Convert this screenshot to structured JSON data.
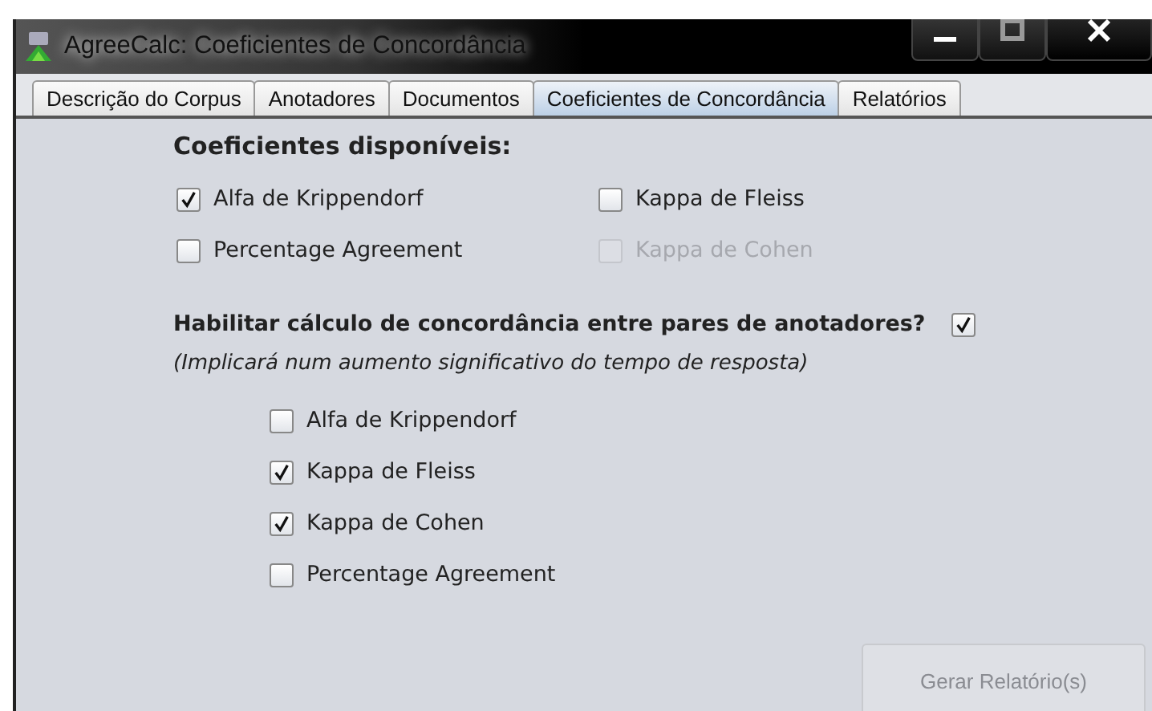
{
  "window": {
    "title": "AgreeCalc: Coeficientes de Concordância"
  },
  "tabs": [
    {
      "label": "Descrição do Corpus",
      "selected": false
    },
    {
      "label": "Anotadores",
      "selected": false
    },
    {
      "label": "Documentos",
      "selected": false
    },
    {
      "label": "Coeficientes de Concordância",
      "selected": true
    },
    {
      "label": "Relatórios",
      "selected": false
    }
  ],
  "available": {
    "heading": "Coeficientes disponíveis:",
    "options": [
      {
        "label": "Alfa de Krippendorf",
        "checked": true,
        "disabled": false
      },
      {
        "label": "Kappa de Fleiss",
        "checked": false,
        "disabled": false
      },
      {
        "label": "Percentage Agreement",
        "checked": false,
        "disabled": false
      },
      {
        "label": "Kappa de Cohen",
        "checked": false,
        "disabled": true
      }
    ]
  },
  "pairs": {
    "question": "Habilitar cálculo de concordância entre pares de anotadores?",
    "checked": true,
    "note": "(Implicará num aumento significativo do tempo de resposta)",
    "options": [
      {
        "label": "Alfa de Krippendorf",
        "checked": false
      },
      {
        "label": "Kappa de Fleiss",
        "checked": true
      },
      {
        "label": "Kappa de Cohen",
        "checked": true
      },
      {
        "label": "Percentage Agreement",
        "checked": false
      }
    ]
  },
  "button": {
    "label": "Gerar Relatório(s)",
    "disabled": true
  }
}
